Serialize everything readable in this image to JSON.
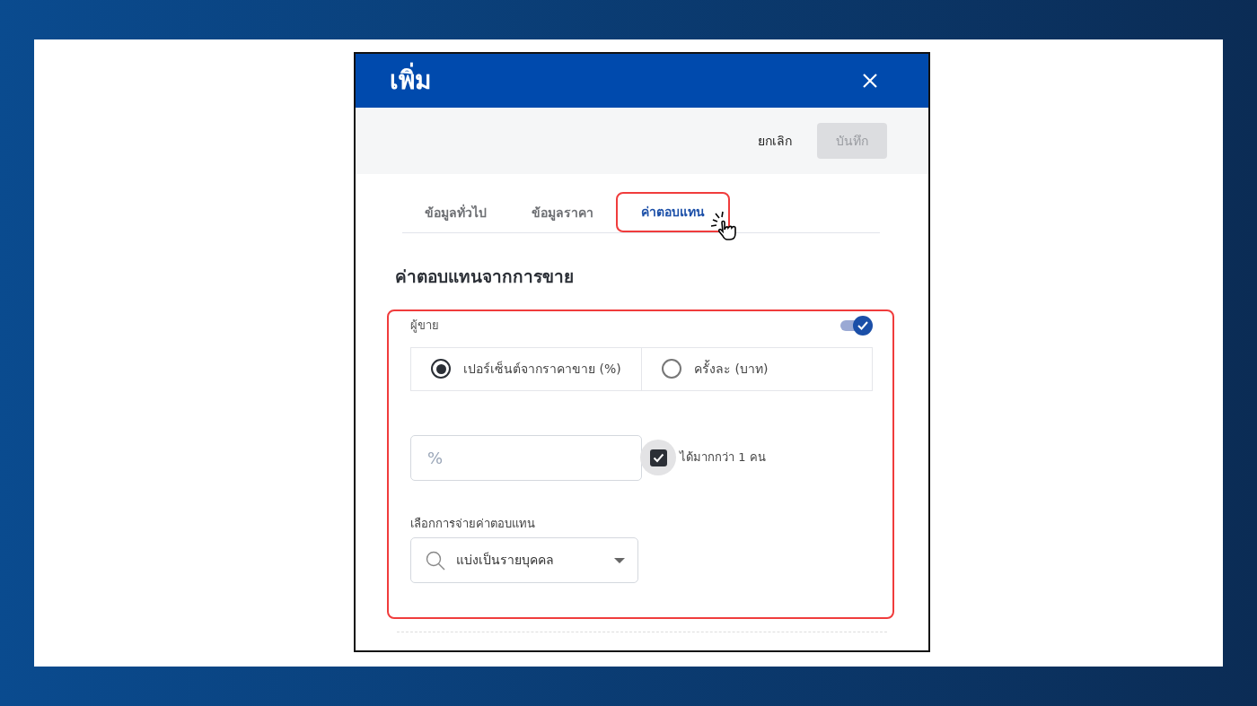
{
  "dialog": {
    "title": "เพิ่ม"
  },
  "toolbar": {
    "buttons": [
      {
        "kind": "text",
        "label": "ยกเลิก"
      },
      {
        "kind": "filled",
        "label": "บันทึก",
        "disabled": true
      }
    ]
  },
  "tabs": [
    {
      "label": "ข้อมูลทั่วไป",
      "selected": false,
      "highlighted": false
    },
    {
      "label": "ข้อมูลราคา",
      "selected": false,
      "highlighted": false
    },
    {
      "label": "ค่าตอบแทน",
      "selected": true,
      "highlighted": true
    }
  ],
  "section": {
    "title": "ค่าตอบแทนจากการขาย",
    "seller": {
      "label": "ผู้ขาย",
      "on": true,
      "options": [
        {
          "label": "เปอร์เซ็นต์จากราคาขาย (%)",
          "selected": true
        },
        {
          "label": "ครั้งละ (บาท)",
          "selected": false
        }
      ],
      "amount": {
        "placeholder": "%"
      },
      "multiple": {
        "label": "ได้มากกว่า 1 คน",
        "checked": true
      },
      "payout": {
        "label": "เลือกการจ่ายค่าตอบแทน",
        "value": "แบ่งเป็นรายบุคคล"
      }
    }
  }
}
